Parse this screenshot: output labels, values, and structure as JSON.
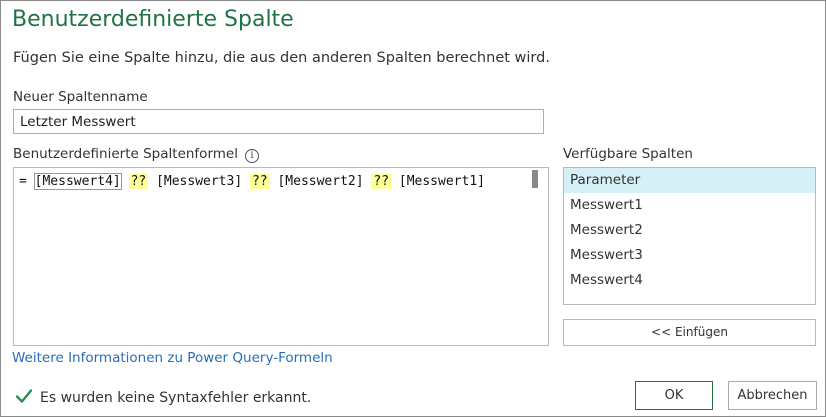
{
  "dialog": {
    "title": "Benutzerdefinierte Spalte",
    "description": "Fügen Sie eine Spalte hinzu, die aus den anderen Spalten berechnet wird."
  },
  "name_field": {
    "label": "Neuer Spaltenname",
    "value": "Letzter Messwert"
  },
  "formula": {
    "label": "Benutzerdefinierte Spaltenformel",
    "info_icon": "i",
    "tokens": {
      "prefix": "= ",
      "col1": "[Messwert4]",
      "op1": "??",
      "col2": "[Messwert3]",
      "op2": "??",
      "col3": "[Messwert2]",
      "op3": "??",
      "col4": "[Messwert1]"
    }
  },
  "available_columns": {
    "label": "Verfügbare Spalten",
    "items": [
      "Parameter",
      "Messwert1",
      "Messwert2",
      "Messwert3",
      "Messwert4"
    ],
    "selected_index": 0,
    "insert_button": "<< Einfügen"
  },
  "help_link": "Weitere Informationen zu Power Query-Formeln",
  "status": {
    "text": "Es wurden keine Syntaxfehler erkannt.",
    "icon": "checkmark-icon",
    "icon_color": "#2e8b57"
  },
  "buttons": {
    "ok": "OK",
    "cancel": "Abbrechen"
  },
  "colors": {
    "accent": "#217346",
    "link": "#2a6fb5",
    "selection": "#d5f1f7",
    "operator_highlight": "#ffff99"
  }
}
